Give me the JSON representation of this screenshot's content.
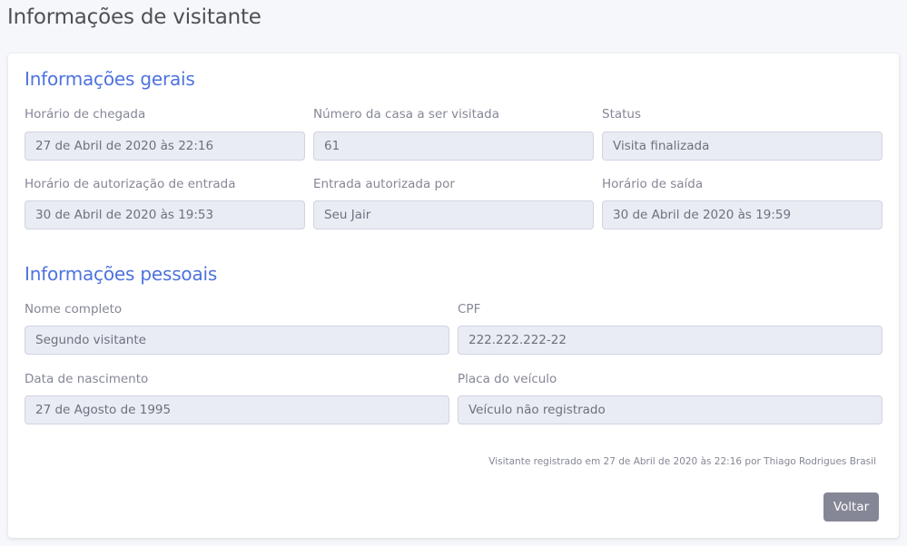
{
  "page": {
    "title": "Informações de visitante"
  },
  "general": {
    "title": "Informações gerais",
    "fields": [
      {
        "label": "Horário de chegada",
        "value": "27 de Abril de 2020 às 22:16"
      },
      {
        "label": "Número da casa a ser visitada",
        "value": "61"
      },
      {
        "label": "Status",
        "value": "Visita finalizada"
      },
      {
        "label": "Horário de autorização de entrada",
        "value": "30 de Abril de 2020 às 19:53"
      },
      {
        "label": "Entrada autorizada por",
        "value": "Seu Jair"
      },
      {
        "label": "Horário de saída",
        "value": "30 de Abril de 2020 às 19:59"
      }
    ]
  },
  "personal": {
    "title": "Informações pessoais",
    "fields": [
      {
        "label": "Nome completo",
        "value": "Segundo visitante"
      },
      {
        "label": "CPF",
        "value": "222.222.222-22"
      },
      {
        "label": "Data de nascimento",
        "value": "27 de Agosto de 1995"
      },
      {
        "label": "Placa do veículo",
        "value": "Veículo não registrado"
      }
    ]
  },
  "footer": {
    "note": "Visitante registrado em 27 de Abril de 2020 às 22:16 por Thiago Rodrigues Brasil",
    "back_label": "Voltar"
  },
  "colors": {
    "accent": "#4e73df",
    "field_bg": "#eaecf4",
    "button_bg": "#858796"
  }
}
